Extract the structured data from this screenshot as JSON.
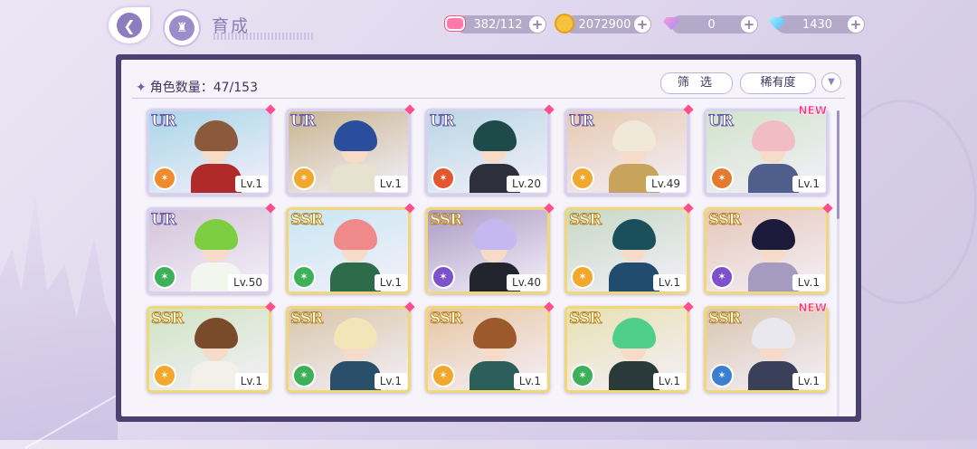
{
  "header": {
    "title": "育成"
  },
  "resources": {
    "stamina": "382/112",
    "coins": "2072900",
    "gems_paid": "0",
    "gems_free": "1430",
    "plus": "+"
  },
  "panel": {
    "count_label": "角色数量：47/153",
    "filter_label": "筛 选",
    "rarity_label": "稀有度"
  },
  "cards": [
    {
      "rarity": "UR",
      "level": "Lv.1",
      "attr_color": "#f08a2c",
      "hair": "#8b5a3c",
      "body": "#b02a2a",
      "bg": "#a9d6e8",
      "new": false
    },
    {
      "rarity": "UR",
      "level": "Lv.1",
      "attr_color": "#f2a82c",
      "hair": "#2a4d9c",
      "body": "#e7e1d0",
      "bg": "#c9b590",
      "new": false
    },
    {
      "rarity": "UR",
      "level": "Lv.20",
      "attr_color": "#e4572e",
      "hair": "#1e4b4a",
      "body": "#2d2f3a",
      "bg": "#b9d7e4",
      "new": false
    },
    {
      "rarity": "UR",
      "level": "Lv.49",
      "attr_color": "#f2a82c",
      "hair": "#f0e8d8",
      "body": "#c7a35c",
      "bg": "#e6c9b0",
      "new": false
    },
    {
      "rarity": "UR",
      "level": "Lv.1",
      "attr_color": "#e47a2e",
      "hair": "#f2bcc4",
      "body": "#4f5f8c",
      "bg": "#cfe4c9",
      "new": true
    },
    {
      "rarity": "UR",
      "level": "Lv.50",
      "attr_color": "#3fb05a",
      "hair": "#7ccd3f",
      "body": "#f3f6ee",
      "bg": "#d4c3d8",
      "new": false
    },
    {
      "rarity": "SSR",
      "level": "Lv.1",
      "attr_color": "#3fb05a",
      "hair": "#f08a8a",
      "body": "#2d6b4a",
      "bg": "#c8e6f2",
      "new": false
    },
    {
      "rarity": "SSR",
      "level": "Lv.40",
      "attr_color": "#7b52c9",
      "hair": "#c5b7f0",
      "body": "#23252e",
      "bg": "#ad9cc4",
      "new": false
    },
    {
      "rarity": "SSR",
      "level": "Lv.1",
      "attr_color": "#f2a82c",
      "hair": "#1c4f5c",
      "body": "#214b6f",
      "bg": "#c7d8c4",
      "new": false
    },
    {
      "rarity": "SSR",
      "level": "Lv.1",
      "attr_color": "#7b52c9",
      "hair": "#1b1a3a",
      "body": "#a59ac0",
      "bg": "#e6c7b8",
      "new": false
    },
    {
      "rarity": "SSR",
      "level": "Lv.1",
      "attr_color": "#f2a82c",
      "hair": "#7a4b2a",
      "body": "#f2f0e8",
      "bg": "#cfe4c2",
      "new": false
    },
    {
      "rarity": "SSR",
      "level": "Lv.1",
      "attr_color": "#3fb05a",
      "hair": "#f2e6b8",
      "body": "#2a4f6a",
      "bg": "#d8c6a8",
      "new": false
    },
    {
      "rarity": "SSR",
      "level": "Lv.1",
      "attr_color": "#f2a82c",
      "hair": "#9c5a2c",
      "body": "#2d5f5a",
      "bg": "#e8c6a2",
      "new": false
    },
    {
      "rarity": "SSR",
      "level": "Lv.1",
      "attr_color": "#3fb05a",
      "hair": "#4fcf8a",
      "body": "#2a3a3a",
      "bg": "#e8e0b0",
      "new": false
    },
    {
      "rarity": "SSR",
      "level": "Lv.1",
      "attr_color": "#3a7fd0",
      "hair": "#e8e8ee",
      "body": "#3a3f5a",
      "bg": "#d9c6b0",
      "new": true
    }
  ],
  "new_label": "NEW"
}
